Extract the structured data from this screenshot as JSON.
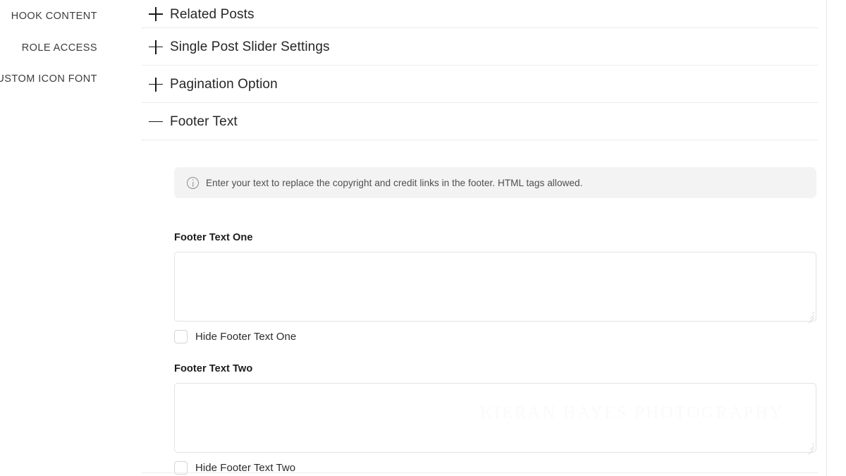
{
  "sidebar": {
    "items": [
      {
        "label": "HOOK CONTENT",
        "name": "hook-content"
      },
      {
        "label": "ROLE ACCESS",
        "name": "role-access"
      },
      {
        "label": "USTOM ICON FONT",
        "name": "custom-icon-font"
      }
    ]
  },
  "accordion": {
    "sections": [
      {
        "label": "Related Posts",
        "icon": "plus-icon",
        "expanded": false
      },
      {
        "label": "Single Post Slider Settings",
        "icon": "plus-icon",
        "expanded": false
      },
      {
        "label": "Pagination Option",
        "icon": "plus-icon",
        "expanded": false
      },
      {
        "label": "Footer Text",
        "icon": "minus-icon",
        "expanded": true
      }
    ]
  },
  "footer_text_panel": {
    "notice": {
      "icon": "info-icon",
      "text": "Enter your text to replace the copyright and credit links in the footer. HTML tags allowed."
    },
    "fields": [
      {
        "label": "Footer Text One",
        "value": "",
        "placeholder": "",
        "watermark": "",
        "checkbox_label": "Hide Footer Text One",
        "checked": false
      },
      {
        "label": "Footer Text Two",
        "value": "",
        "placeholder": "",
        "watermark": "KIERAN HAYES PHOTOGRAPHY",
        "checkbox_label": "Hide Footer Text Two",
        "checked": false
      }
    ]
  },
  "colors": {
    "notice_background": "#f3f3f3",
    "border": "#e2e2e2",
    "divider": "#ededed",
    "text_primary": "#262626",
    "watermark": "#fafafa"
  }
}
